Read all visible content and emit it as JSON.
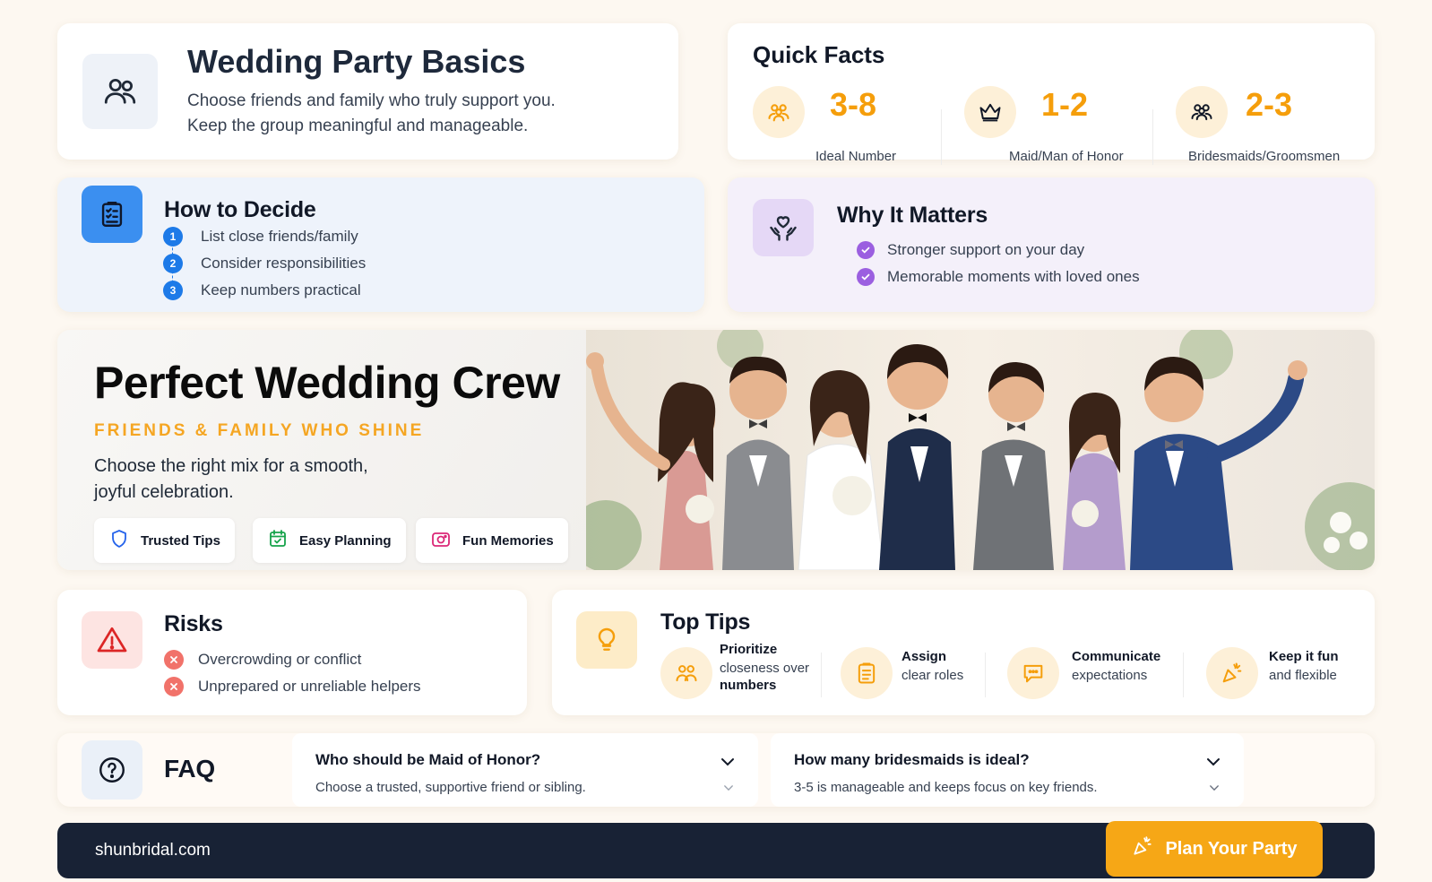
{
  "basics": {
    "title": "Wedding Party Basics",
    "line1": "Choose friends and family who truly support you.",
    "line2": "Keep the group meaningful and manageable.",
    "icon": "people-icon"
  },
  "quick_facts": {
    "title": "Quick Facts",
    "items": [
      {
        "value": "3-8",
        "label": "Ideal Number",
        "icon": "group-icon"
      },
      {
        "value": "1-2",
        "label": "Maid/Man of Honor",
        "icon": "crown-icon"
      },
      {
        "value": "2-3",
        "label": "Bridesmaids/Groomsmen",
        "icon": "people-icon"
      }
    ],
    "accent": "#f59e0b"
  },
  "decide": {
    "title": "How to Decide",
    "steps": [
      {
        "num": "1",
        "text": "List close friends/family"
      },
      {
        "num": "2",
        "text": "Consider responsibilities"
      },
      {
        "num": "3",
        "text": "Keep numbers practical"
      }
    ],
    "icon": "clipboard-icon"
  },
  "why": {
    "title": "Why It Matters",
    "points": [
      "Stronger support on your day",
      "Memorable moments with loved ones"
    ],
    "icon": "heart-hands-icon"
  },
  "hero": {
    "headline": "Perfect Wedding Crew",
    "kicker": "FRIENDS & FAMILY WHO SHINE",
    "sub": "Choose the right mix for a smooth, joyful celebration.",
    "pills": [
      {
        "label": "Trusted Tips",
        "icon": "shield-icon"
      },
      {
        "label": "Easy Planning",
        "icon": "calendar-check-icon"
      },
      {
        "label": "Fun Memories",
        "icon": "camera-icon"
      }
    ]
  },
  "risks": {
    "title": "Risks",
    "items": [
      "Overcrowding or conflict",
      "Unprepared or unreliable helpers"
    ],
    "icon": "warning-icon"
  },
  "tips": {
    "title": "Top Tips",
    "items": [
      {
        "bold": "Prioritize",
        "rest": "closeness over",
        "rest_bold": "numbers",
        "icon": "people-icon"
      },
      {
        "bold": "Assign",
        "rest": "clear roles",
        "icon": "clipboard-icon"
      },
      {
        "bold": "Communicate",
        "rest": "expectations",
        "icon": "chat-icon"
      },
      {
        "bold": "Keep it fun",
        "rest": "and flexible",
        "icon": "party-popper-icon"
      }
    ],
    "icon": "lightbulb-icon"
  },
  "faq": {
    "title": "FAQ",
    "items": [
      {
        "q": "Who should be Maid of Honor?",
        "a": "Choose a trusted, supportive friend or sibling."
      },
      {
        "q": "How many bridesmaids is ideal?",
        "a": "3-5 is manageable and keeps focus on key friends."
      }
    ]
  },
  "footer": {
    "site": "shunbridal.com",
    "cta": "Plan Your Party"
  }
}
